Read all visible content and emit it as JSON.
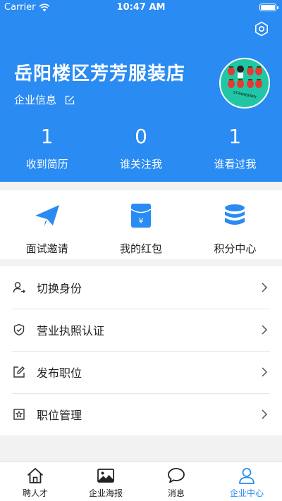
{
  "status_bar": {
    "carrier": "Carrier",
    "time": "10:47 AM"
  },
  "header": {
    "shop_name": "岳阳楼区芳芳服装店",
    "company_info_label": "企业信息",
    "avatar_text": "STRAWBERRY",
    "colors": {
      "background": "#2a8bf2",
      "avatar_bg": "#21c7a4"
    }
  },
  "stats": [
    {
      "value": "1",
      "label": "收到简历"
    },
    {
      "value": "0",
      "label": "谁关注我"
    },
    {
      "value": "1",
      "label": "谁看过我"
    }
  ],
  "quick_actions": [
    {
      "icon": "paper-plane-icon",
      "label": "面试邀请"
    },
    {
      "icon": "red-envelope-icon",
      "label": "我的红包"
    },
    {
      "icon": "coin-stack-icon",
      "label": "积分中心"
    }
  ],
  "menu": [
    {
      "icon": "switch-user-icon",
      "label": "切换身份"
    },
    {
      "icon": "shield-check-icon",
      "label": "营业执照认证"
    },
    {
      "icon": "edit-icon",
      "label": "发布职位"
    },
    {
      "icon": "badge-icon",
      "label": "职位管理"
    }
  ],
  "tabs": [
    {
      "icon": "home-icon",
      "label": "聘人才",
      "active": false
    },
    {
      "icon": "image-icon",
      "label": "企业海报",
      "active": false
    },
    {
      "icon": "chat-bubble-icon",
      "label": "消息",
      "active": false
    },
    {
      "icon": "user-icon",
      "label": "企业中心",
      "active": true
    }
  ],
  "accent_color": "#2a8bf2"
}
